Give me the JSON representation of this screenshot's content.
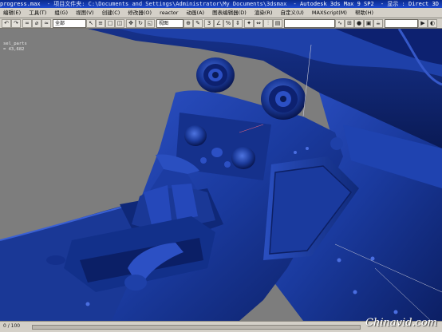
{
  "window": {
    "title_parts": [
      "progress.max",
      "- 项目文件夹: C:\\Documents and Settings\\Administrator\\My Documents\\3dsmax",
      "- Autodesk 3ds Max 9 SP2",
      "- 显示 : Direct 3D"
    ]
  },
  "menu": {
    "items": [
      "编辑(E)",
      "工具(T)",
      "组(G)",
      "视图(V)",
      "创建(C)",
      "修改器(O)",
      "reactor",
      "动画(A)",
      "图表编辑器(D)",
      "渲染(R)",
      "自定义(U)",
      "MAXScript(M)",
      "帮助(H)"
    ]
  },
  "toolbar": {
    "selection_filter": "全部",
    "coord_system": "视图"
  },
  "viewport": {
    "stats_name": "sel_parts",
    "stats_value": "= 43,682",
    "background_color": "#7d7d7d",
    "model_color": "#1b3a9a"
  },
  "status": {
    "frame_counter": "0 / 100"
  },
  "watermark": {
    "text": "Chinavid.com"
  }
}
